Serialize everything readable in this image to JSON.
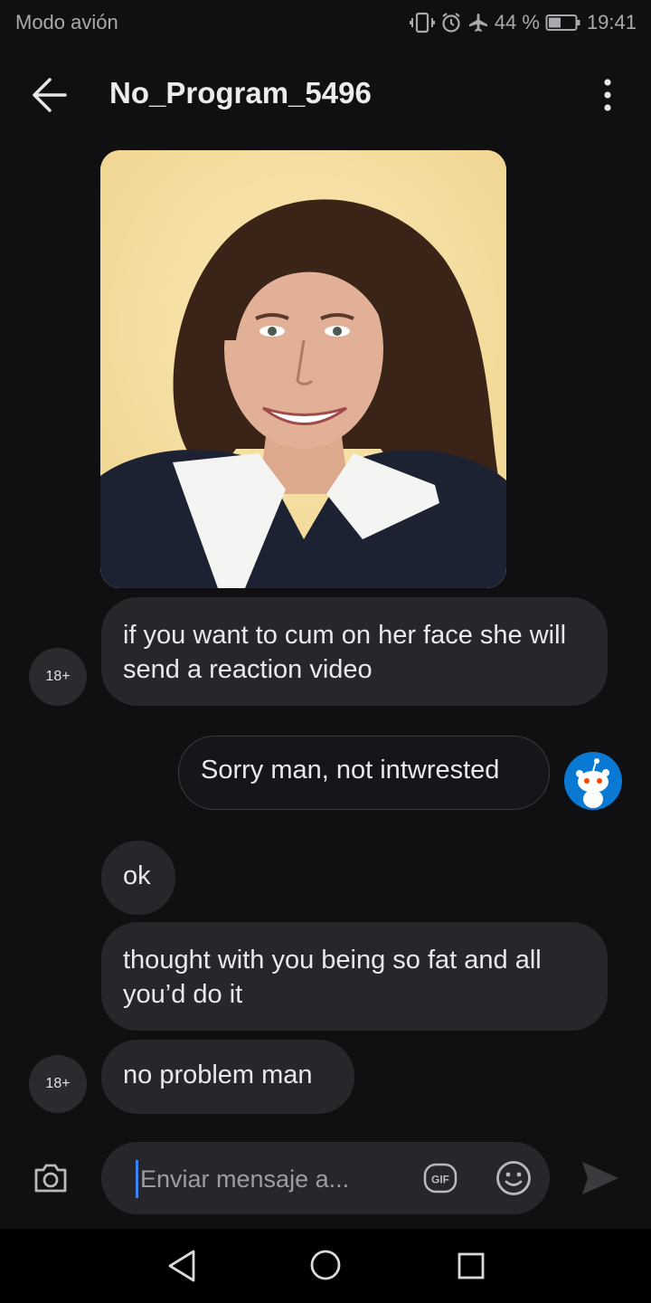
{
  "status_bar": {
    "left_text": "Modo avión",
    "battery_percent": "44 %",
    "time": "19:41",
    "icons": [
      "vibrate-icon",
      "alarm-icon",
      "airplane-icon",
      "battery-icon"
    ]
  },
  "header": {
    "title": "No_Program_5496",
    "back_icon": "arrow-left-icon",
    "menu_icon": "more-vertical-icon"
  },
  "messages": [
    {
      "type": "image",
      "from": "them",
      "description": "portrait photo"
    },
    {
      "type": "text",
      "from": "them",
      "avatar_label": "18+",
      "text": "if you want to cum on her face she will send a reaction video"
    },
    {
      "type": "text",
      "from": "me",
      "text": "Sorry man, not intwrested"
    },
    {
      "type": "text",
      "from": "them",
      "text": "ok"
    },
    {
      "type": "text",
      "from": "them",
      "text": "thought with you being so fat and all you’d do it"
    },
    {
      "type": "text",
      "from": "them",
      "avatar_label": "18+",
      "text": "no problem man"
    }
  ],
  "composer": {
    "placeholder": "Enviar mensaje a...",
    "gif_label": "GIF",
    "icons": [
      "camera-icon",
      "gif-icon",
      "emoji-icon",
      "send-icon"
    ]
  },
  "nav_bar": {
    "icons": [
      "nav-back-icon",
      "nav-home-icon",
      "nav-recents-icon"
    ]
  },
  "colors": {
    "background": "#101012",
    "bubble": "#26262b",
    "accent_cursor": "#3b82f6",
    "avatar_blue": "#0a79d4"
  }
}
